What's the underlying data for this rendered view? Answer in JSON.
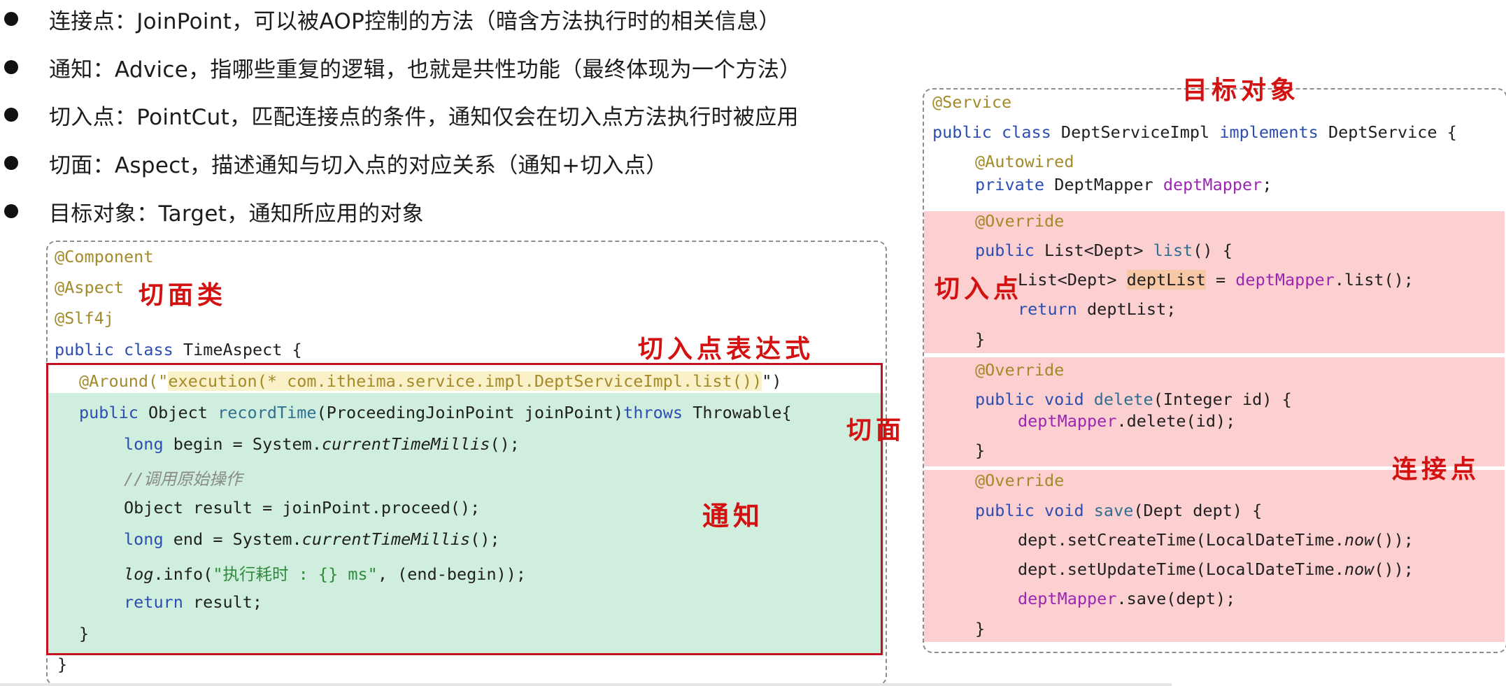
{
  "bullets": [
    "连接点：JoinPoint，可以被AOP控制的方法（暗含方法执行时的相关信息）",
    "通知：Advice，指哪些重复的逻辑，也就是共性功能（最终体现为一个方法）",
    "切入点：PointCut，匹配连接点的条件，通知仅会在切入点方法执行时被应用",
    "切面：Aspect，描述通知与切入点的对应关系（通知+切入点）",
    "目标对象：Target，通知所应用的对象"
  ],
  "left_code": {
    "l1": "@Component",
    "l2": "@Aspect",
    "l3": "@Slf4j",
    "l4_kw": "public class",
    "l4_name": " TimeAspect {",
    "l5_ann": "@Around(\"",
    "l5_expr": "execution(* com.itheima.service.impl.DeptServiceImpl.list())",
    "l5_end": "\")",
    "l6_kw": "public",
    "l6_a": " Object ",
    "l6_fn": "recordTime",
    "l6_b": "(ProceedingJoinPoint joinPoint)",
    "l6_kw2": "throws",
    "l6_c": " Throwable{",
    "l7_kw": "long",
    "l7_a": " begin = System.",
    "l7_it": "currentTimeMillis",
    "l7_b": "();",
    "l8": "//调用原始操作",
    "l9": "Object result = joinPoint.proceed();",
    "l10_kw": "long",
    "l10_a": " end = System.",
    "l10_it": "currentTimeMillis",
    "l10_b": "();",
    "l11_it": "log",
    "l11_a": ".info(",
    "l11_st": "\"执行耗时 : {} ms\"",
    "l11_b": ", (end-begin));",
    "l12_kw": "return",
    "l12_a": " result;",
    "l13": "}",
    "l14": "}"
  },
  "right_code": {
    "r1": "@Service",
    "r2_kw": "public class",
    "r2_a": " DeptServiceImpl ",
    "r2_kw2": "implements",
    "r2_b": " DeptService {",
    "r3": "@Autowired",
    "r4_kw": "private",
    "r4_a": " DeptMapper ",
    "r4_pu": "deptMapper",
    "r4_b": ";",
    "r5": "@Override",
    "r6_kw": "public",
    "r6_a": " List<Dept> ",
    "r6_fn": "list",
    "r6_b": "() {",
    "r7_a": "List<Dept> ",
    "r7_hl": "deptList",
    "r7_b": " = ",
    "r7_pu": "deptMapper",
    "r7_c": ".list();",
    "r8_kw": "return",
    "r8_a": " deptList;",
    "r9": "}",
    "r10": "@Override",
    "r11_kw": "public void",
    "r11_fn": " delete",
    "r11_a": "(Integer id) {",
    "r12_pu": "deptMapper",
    "r12_a": ".delete(id);",
    "r13": "}",
    "r14": "@Override",
    "r15_kw": "public void",
    "r15_fn": " save",
    "r15_a": "(Dept dept) {",
    "r16_a": "dept.setCreateTime(LocalDateTime.",
    "r16_it": "now",
    "r16_b": "());",
    "r17_a": "dept.setUpdateTime(LocalDateTime.",
    "r17_it": "now",
    "r17_b": "());",
    "r18_pu": "deptMapper",
    "r18_a": ".save(dept);",
    "r19": "}"
  },
  "annotations": {
    "aspect_class": "切面类",
    "pointcut_expr": "切入点表达式",
    "aspect": "切面",
    "advice": "通知",
    "target": "目标对象",
    "pointcut": "切入点",
    "joinpoint": "连接点"
  },
  "colors": {
    "annotation": "#a38a2b",
    "keyword": "#2c4db2",
    "advice_bg": "#cfeede",
    "joinpoint_bg": "#fccfd0",
    "frame_red": "#c1121f",
    "handwriting_red": "#d31111"
  }
}
